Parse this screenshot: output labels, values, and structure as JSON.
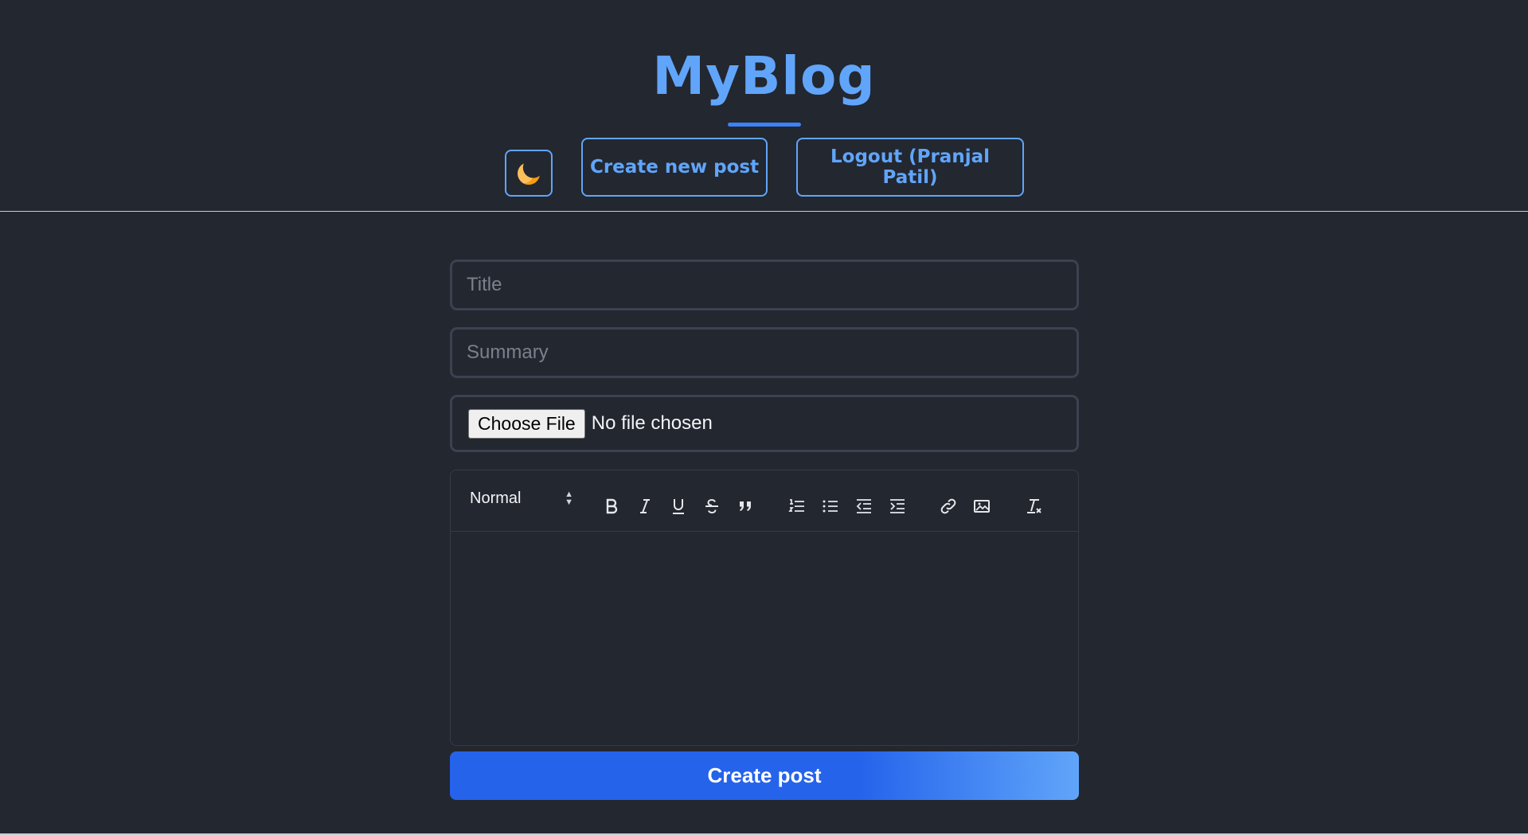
{
  "header": {
    "logo": "MyBlog",
    "create_label": "Create new post",
    "logout_label": "Logout (Pranjal Patil)",
    "theme_icon": "moon-icon"
  },
  "form": {
    "title_placeholder": "Title",
    "summary_placeholder": "Summary",
    "file_button": "Choose File",
    "file_status": "No file chosen",
    "editor": {
      "format_value": "Normal",
      "tools": [
        "bold",
        "italic",
        "underline",
        "strike",
        "blockquote",
        "ordered-list",
        "bullet-list",
        "outdent",
        "indent",
        "link",
        "image",
        "clean"
      ],
      "content": ""
    },
    "submit_label": "Create post"
  },
  "colors": {
    "background": "#232730",
    "accent": "#60a5fa",
    "primary": "#2563eb"
  }
}
